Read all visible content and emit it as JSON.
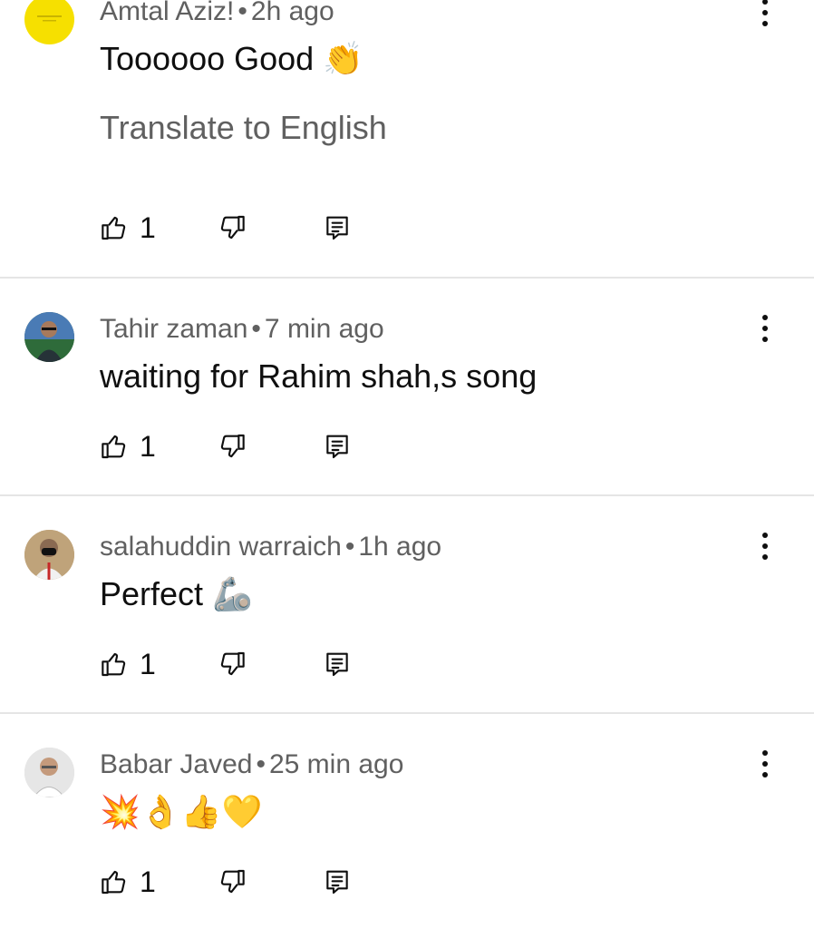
{
  "comments": [
    {
      "author": "Amtal Aziz!",
      "time": "2h ago",
      "text": "Toooooo Good",
      "emoji": "👏",
      "translate_label": "Translate to English",
      "likes": "1",
      "avatar_color": "#f6e000"
    },
    {
      "author": "Tahir zaman",
      "time": "7 min ago",
      "text": "waiting for Rahim shah,s song",
      "likes": "1",
      "avatar_color": "#3d6b4a"
    },
    {
      "author": "salahuddin warraich",
      "time": "1h ago",
      "text": "Perfect",
      "emoji": "🦾",
      "likes": "1",
      "avatar_color": "#c9a978"
    },
    {
      "author": "Babar Javed",
      "time": "25 min ago",
      "text": "",
      "emoji": "💥👌👍💛",
      "likes": "1",
      "avatar_color": "#d9d9d9"
    }
  ],
  "icons": {
    "like": "thumbs-up-icon",
    "dislike": "thumbs-down-icon",
    "reply": "reply-icon",
    "menu": "more-vert-icon"
  },
  "separator": "•"
}
